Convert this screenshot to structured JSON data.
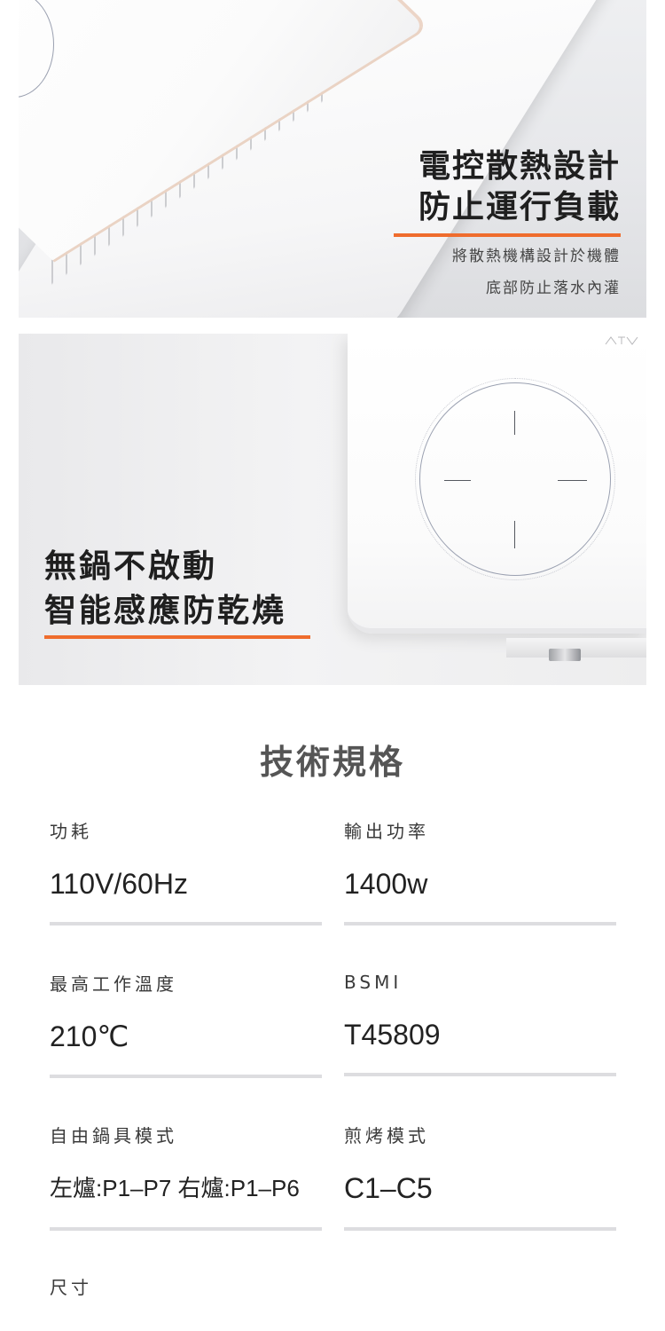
{
  "panel_heat": {
    "title_lines": [
      "電控散熱設計",
      "防止運行負載"
    ],
    "subtitle_lines": [
      "將散熱機構設計於機體",
      "底部防止落水內灌"
    ],
    "accent_color": "#ef6c2d"
  },
  "panel_sensor": {
    "title_lines": [
      "無鍋不啟動",
      "智能感應防乾燒"
    ],
    "accent_color": "#ef6c2d"
  },
  "specs": {
    "heading": "技術規格",
    "items": [
      {
        "label": "功耗",
        "value": "110V/60Hz"
      },
      {
        "label": "輸出功率",
        "value": "1400w"
      },
      {
        "label": "最高工作溫度",
        "value": "210℃"
      },
      {
        "label": "BSMI",
        "value": "T45809"
      },
      {
        "label": "自由鍋具模式",
        "value": "左爐:P1–P7 右爐:P1–P6"
      },
      {
        "label": "煎烤模式",
        "value": "C1–C5"
      },
      {
        "label": "尺寸",
        "value": ""
      }
    ]
  }
}
